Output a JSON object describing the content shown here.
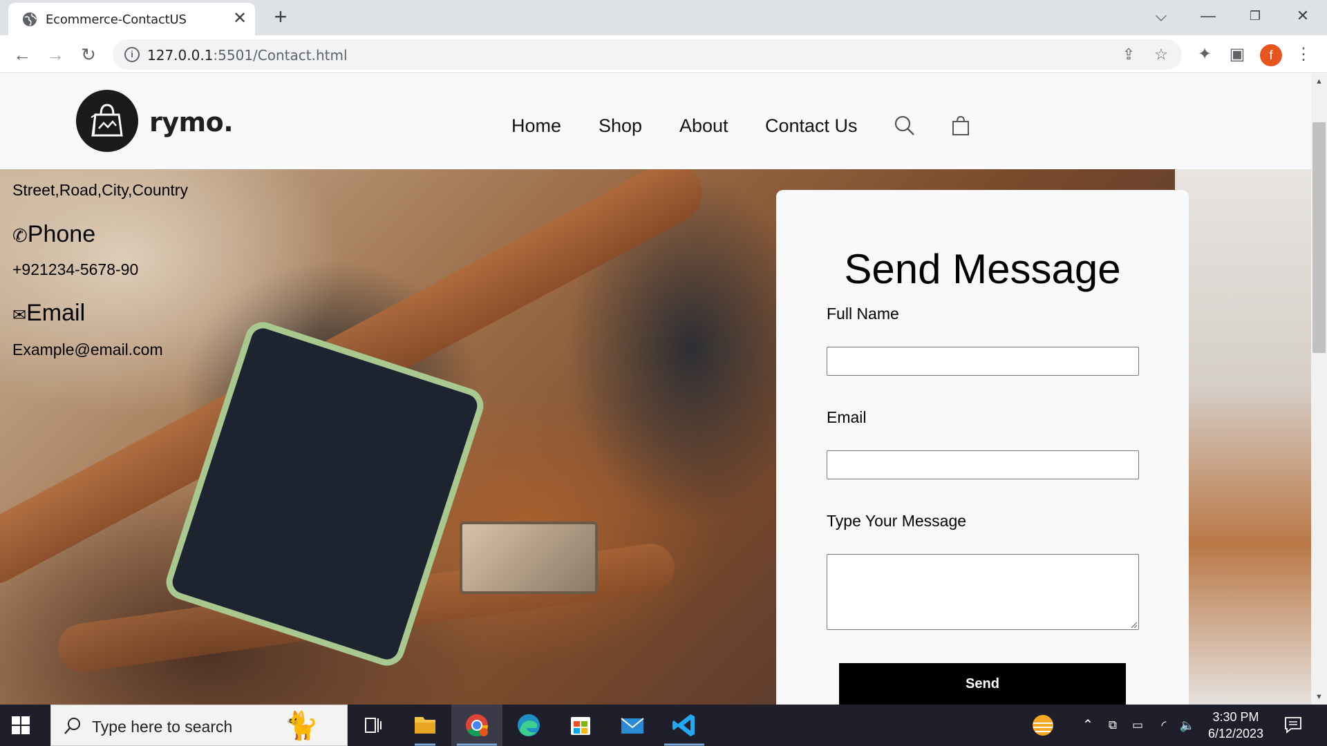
{
  "browser": {
    "tab_title": "Ecommerce-ContactUS",
    "tab_close": "✕",
    "new_tab": "+",
    "url_host": "127.0.0.1",
    "url_rest": ":5501/Contact.html",
    "profile_initial": "f"
  },
  "site": {
    "logo_text": "rymo.",
    "nav": [
      "Home",
      "Shop",
      "About",
      "Contact Us"
    ]
  },
  "contact": {
    "address": "Street,Road,City,Country",
    "phone_heading": "Phone",
    "phone_icon": "✆",
    "phone": "+921234-5678-90",
    "email_heading": "Email",
    "email_icon": "✉",
    "email": "Example@email.com"
  },
  "form": {
    "title": "Send Message",
    "name_label": "Full Name",
    "email_label": "Email",
    "message_label": "Type Your Message",
    "send_label": "Send"
  },
  "taskbar": {
    "search_placeholder": "Type here to search",
    "time": "3:30 PM",
    "date": "6/12/2023"
  }
}
